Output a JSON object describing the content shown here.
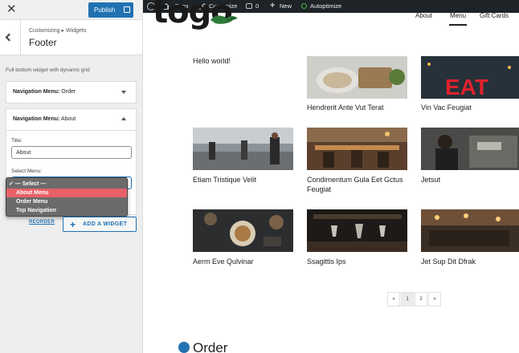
{
  "customizer": {
    "publish_label": "Publish",
    "breadcrumb": "Customizing ▸ Widgets",
    "section_title": "Footer",
    "description": "Full bottom widget with dynamic grid",
    "widgets": [
      {
        "label": "Navigation Menu:",
        "value": "Order"
      },
      {
        "label": "Navigation Menu:",
        "value": "About"
      }
    ],
    "title_label": "Title:",
    "title_value": "About",
    "select_label": "Select Menu:",
    "select_options": [
      "✓ — Select —",
      "About Menu",
      "Order Menu",
      "Top Navigation"
    ],
    "reorder_label": "REORDER",
    "add_widget_label": "ADD A WIDGET"
  },
  "adminbar": {
    "site_name": "Togo",
    "customize": "Customize",
    "comments_count": "0",
    "new_label": "New",
    "autoptimize": "Autoptimize"
  },
  "site": {
    "logo_text": "togo",
    "nav": [
      "About",
      "Menu",
      "Gift Cards"
    ]
  },
  "posts": [
    {
      "title": "Hello world!"
    },
    {
      "title": "Hendrerit Ante Vut Terat"
    },
    {
      "title": "Vin Vac Feugiat"
    },
    {
      "title": "Etiam Tristique Velit"
    },
    {
      "title": "Condimentum Gula Eet Gctus Feugiat"
    },
    {
      "title": "Jetsut"
    },
    {
      "title": "Aerm Eve Qulvinar"
    },
    {
      "title": "Ssagittis Ips"
    },
    {
      "title": "Jet Sup Dit Dfrak"
    }
  ],
  "pagination": [
    "«",
    "1",
    "2",
    "»"
  ],
  "order_heading": "Order",
  "colors": {
    "accent": "#2271b1",
    "highlight": "#e8616a",
    "adminbar": "#1d2327"
  }
}
